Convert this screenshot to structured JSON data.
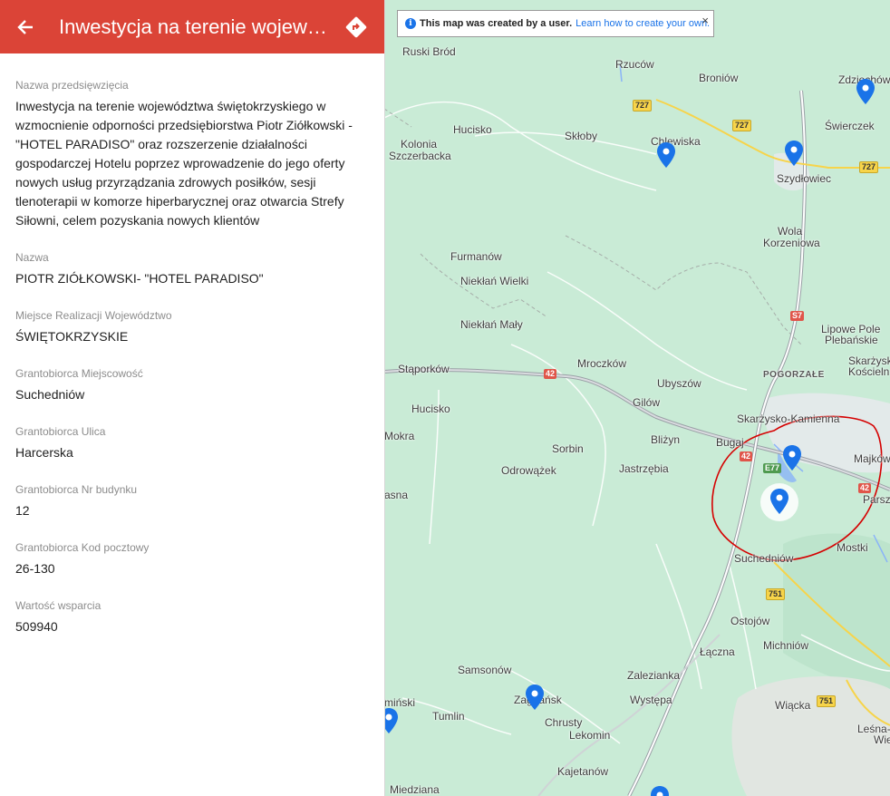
{
  "header": {
    "title": "Inwestycja na terenie wojewód…"
  },
  "fields": [
    {
      "label": "Nazwa przedsięwzięcia",
      "value": "Inwestycja na terenie województwa świętokrzyskiego w wzmocnienie odporności przedsiębiorstwa Piotr Ziółkowski - \"HOTEL PARADISO\" oraz rozszerzenie działalności gospodarczej Hotelu poprzez wprowadzenie do jego oferty nowych usług przyrządzania zdrowych posiłków, sesji tlenoterapii w komorze hiperbarycznej oraz otwarcia Strefy Siłowni, celem pozyskania nowych klientów"
    },
    {
      "label": "Nazwa",
      "value": "PIOTR ZIÓŁKOWSKI- \"HOTEL PARADISO\""
    },
    {
      "label": "Miejsce Realizacji Województwo",
      "value": "ŚWIĘTOKRZYSKIE"
    },
    {
      "label": "Grantobiorca Miejscowość",
      "value": "Suchedniów"
    },
    {
      "label": "Grantobiorca Ulica",
      "value": "Harcerska"
    },
    {
      "label": "Grantobiorca Nr budynku",
      "value": "12"
    },
    {
      "label": "Grantobiorca Kod pocztowy",
      "value": "26-130"
    },
    {
      "label": "Wartość wsparcia",
      "value": "509940"
    }
  ],
  "map": {
    "notice": {
      "icon": "info-icon",
      "text": "This map was created by a user.",
      "link": "Learn how to create your own.",
      "close": "×"
    },
    "places": [
      "Ruski Bród",
      "Rzuców",
      "Broniów",
      "Zdziechów",
      "Hucisko",
      "Skłoby",
      "Chlewiska",
      "Świerczek",
      "Kolonia",
      "Szczerbacka",
      "Szydłowiec",
      "Wola",
      "Korzeniowa",
      "Furmanów",
      "Niekłań Wielki",
      "Niekłań Mały",
      "Lipowe Pole",
      "Plebańskie",
      "Mroczków",
      "Stąporków",
      "POGORZAŁE",
      "Skarżysk",
      "Kościeln",
      "Ubyszów",
      "Gilów",
      "Hucisko",
      "Skarżysko-Kamienna",
      "Mokra",
      "Bliżyn",
      "Bugaj",
      "Sorbin",
      "Majków",
      "Odrowążek",
      "Jastrzębia",
      "asna",
      "Parsz",
      "Mostki",
      "Suchedniów",
      "Ostojów",
      "Michniów",
      "Łączna",
      "Samsonów",
      "Zalezianka",
      "Zagnańsk",
      "Występa",
      "Wiącka",
      "Tumlin",
      "Chrusty",
      "Lekomin",
      "Leśna-",
      "Wie",
      "Kajetanów",
      "miński",
      "Miedziana"
    ],
    "shields": [
      {
        "label": "727",
        "style": "yellow"
      },
      {
        "label": "727",
        "style": "yellow"
      },
      {
        "label": "727",
        "style": "yellow"
      },
      {
        "label": "S7",
        "style": "red"
      },
      {
        "label": "42",
        "style": "red"
      },
      {
        "label": "42",
        "style": "red"
      },
      {
        "label": "E77",
        "style": "green"
      },
      {
        "label": "42",
        "style": "red"
      },
      {
        "label": "751",
        "style": "yellow"
      },
      {
        "label": "751",
        "style": "yellow"
      }
    ],
    "pin_color": "#1a73e8",
    "highlight_color": "#d50000",
    "map_bg": "#c9ebd6"
  }
}
